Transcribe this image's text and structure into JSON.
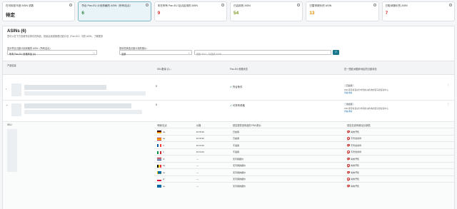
{
  "cards": [
    {
      "label": "在可用亚马逊 ASIN 总数",
      "value": "待定"
    },
    {
      "label": "符合 Pan-EU 计划资格的 ASIN（所有站点）",
      "value": "6"
    },
    {
      "label": "未在所有 Pan-EU 站点启用的 ASIN",
      "value": "9"
    },
    {
      "label": "已启用的 ASIN",
      "value": "54"
    },
    {
      "label": "已暂停报价的 ASIN",
      "value": "13"
    },
    {
      "label": "已取消报价的 ASIN",
      "value": "7"
    }
  ],
  "card_value_colors": [
    "#222222",
    "#2e8540",
    "#d0312d",
    "#7a9a1f",
    "#e08b00",
    "#d0312d"
  ],
  "panel": {
    "title": "ASINs (6)",
    "subtitle": "您可以在下方查看符合条件的商品，批量启用或管理泛欧计划（Pan-EU）中的 ASIN。了解更多"
  },
  "filters": {
    "filter1_label": "显示符合泛欧计划资格的 ASIN（所有站点）",
    "filter1_value": "所有 Pan-EU 资格商品 (6)",
    "filter2_label": "按状态筛选泛欧计划的报价：",
    "filter2_value": "全部",
    "search_placeholder": "搜索 SKU、标题或 ASIN"
  },
  "columns": {
    "product": "产品信息",
    "sku_count": "SKU数量 (1) ↓",
    "pan_eu": "Pan-EU 资格状态",
    "actions": "在一些欧洲国家/地区的泛欧状态"
  },
  "products": [
    {
      "count": "0",
      "status": "符合条件",
      "pill": "已启用",
      "note": "FBA 库存将自动分布到欧洲各地的亚马逊运营中心",
      "link": "查看详情"
    },
    {
      "count": "0",
      "status": "可享有资格",
      "pill": "未启用",
      "note": "FBA 库存将自动分布到欧洲各地的亚马逊运营中心",
      "link": "查看详情"
    }
  ],
  "subtable": {
    "sku": "SKU",
    "market": "商城/站点",
    "price": "价格",
    "prep": "是否提供该商品的 FBA 报价",
    "buyable": "是否在该商城/站点销售"
  },
  "markets": [
    {
      "cc": "de",
      "price": "€178.99",
      "prep": "已启用",
      "buy": "尚未开售"
    },
    {
      "cc": "es",
      "price": "€178.99",
      "prep": "已启用",
      "buy": "不符合条件"
    },
    {
      "cc": "fr",
      "price": "€170.00",
      "prep": "不适用",
      "buy": "不符合条件"
    },
    {
      "cc": "it",
      "price": "€170.00",
      "prep": "不适用",
      "buy": "不符合条件"
    },
    {
      "cc": "nl",
      "price": "—",
      "prep": "无可用报价",
      "buy": "尚未开售"
    },
    {
      "cc": "be",
      "price": "—",
      "prep": "无可用的报价",
      "buy": "尚未开售"
    },
    {
      "cc": "se",
      "price": "—",
      "prep": "无可用的报价",
      "buy": "尚未开售"
    },
    {
      "cc": "pl",
      "price": "—",
      "prep": "无可用的报价",
      "buy": "尚未开售"
    },
    {
      "cc": "se",
      "price": "—",
      "prep": "无可用的报价",
      "buy": "尚未开售"
    }
  ]
}
